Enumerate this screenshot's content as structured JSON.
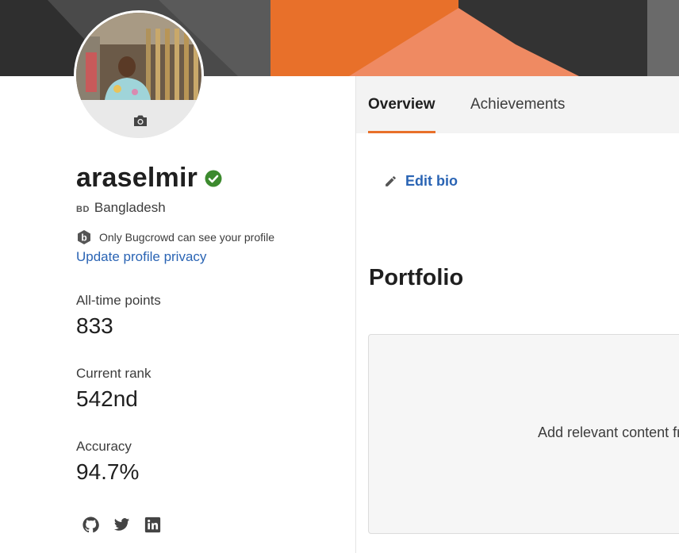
{
  "profile": {
    "username": "araselmir",
    "country_code": "BD",
    "country": "Bangladesh",
    "privacy_notice": "Only Bugcrowd can see your profile",
    "privacy_link": "Update profile privacy"
  },
  "stats": [
    {
      "label": "All-time points",
      "value": "833"
    },
    {
      "label": "Current rank",
      "value": "542nd"
    },
    {
      "label": "Accuracy",
      "value": "94.7%"
    }
  ],
  "socials": [
    "github-icon",
    "twitter-icon",
    "linkedin-icon"
  ],
  "tabs": [
    {
      "label": "Overview",
      "active": true
    },
    {
      "label": "Achievements",
      "active": false
    }
  ],
  "bio": {
    "edit_label": "Edit bio"
  },
  "portfolio": {
    "title": "Portfolio",
    "empty_text": "Add relevant content fr"
  },
  "colors": {
    "accent": "#e8702a",
    "link": "#2a64b4",
    "verified": "#3c8a2e",
    "banner_dark": "#3a3a3a",
    "banner_orange": "#e8702a",
    "banner_salmon": "#ef8a62"
  }
}
